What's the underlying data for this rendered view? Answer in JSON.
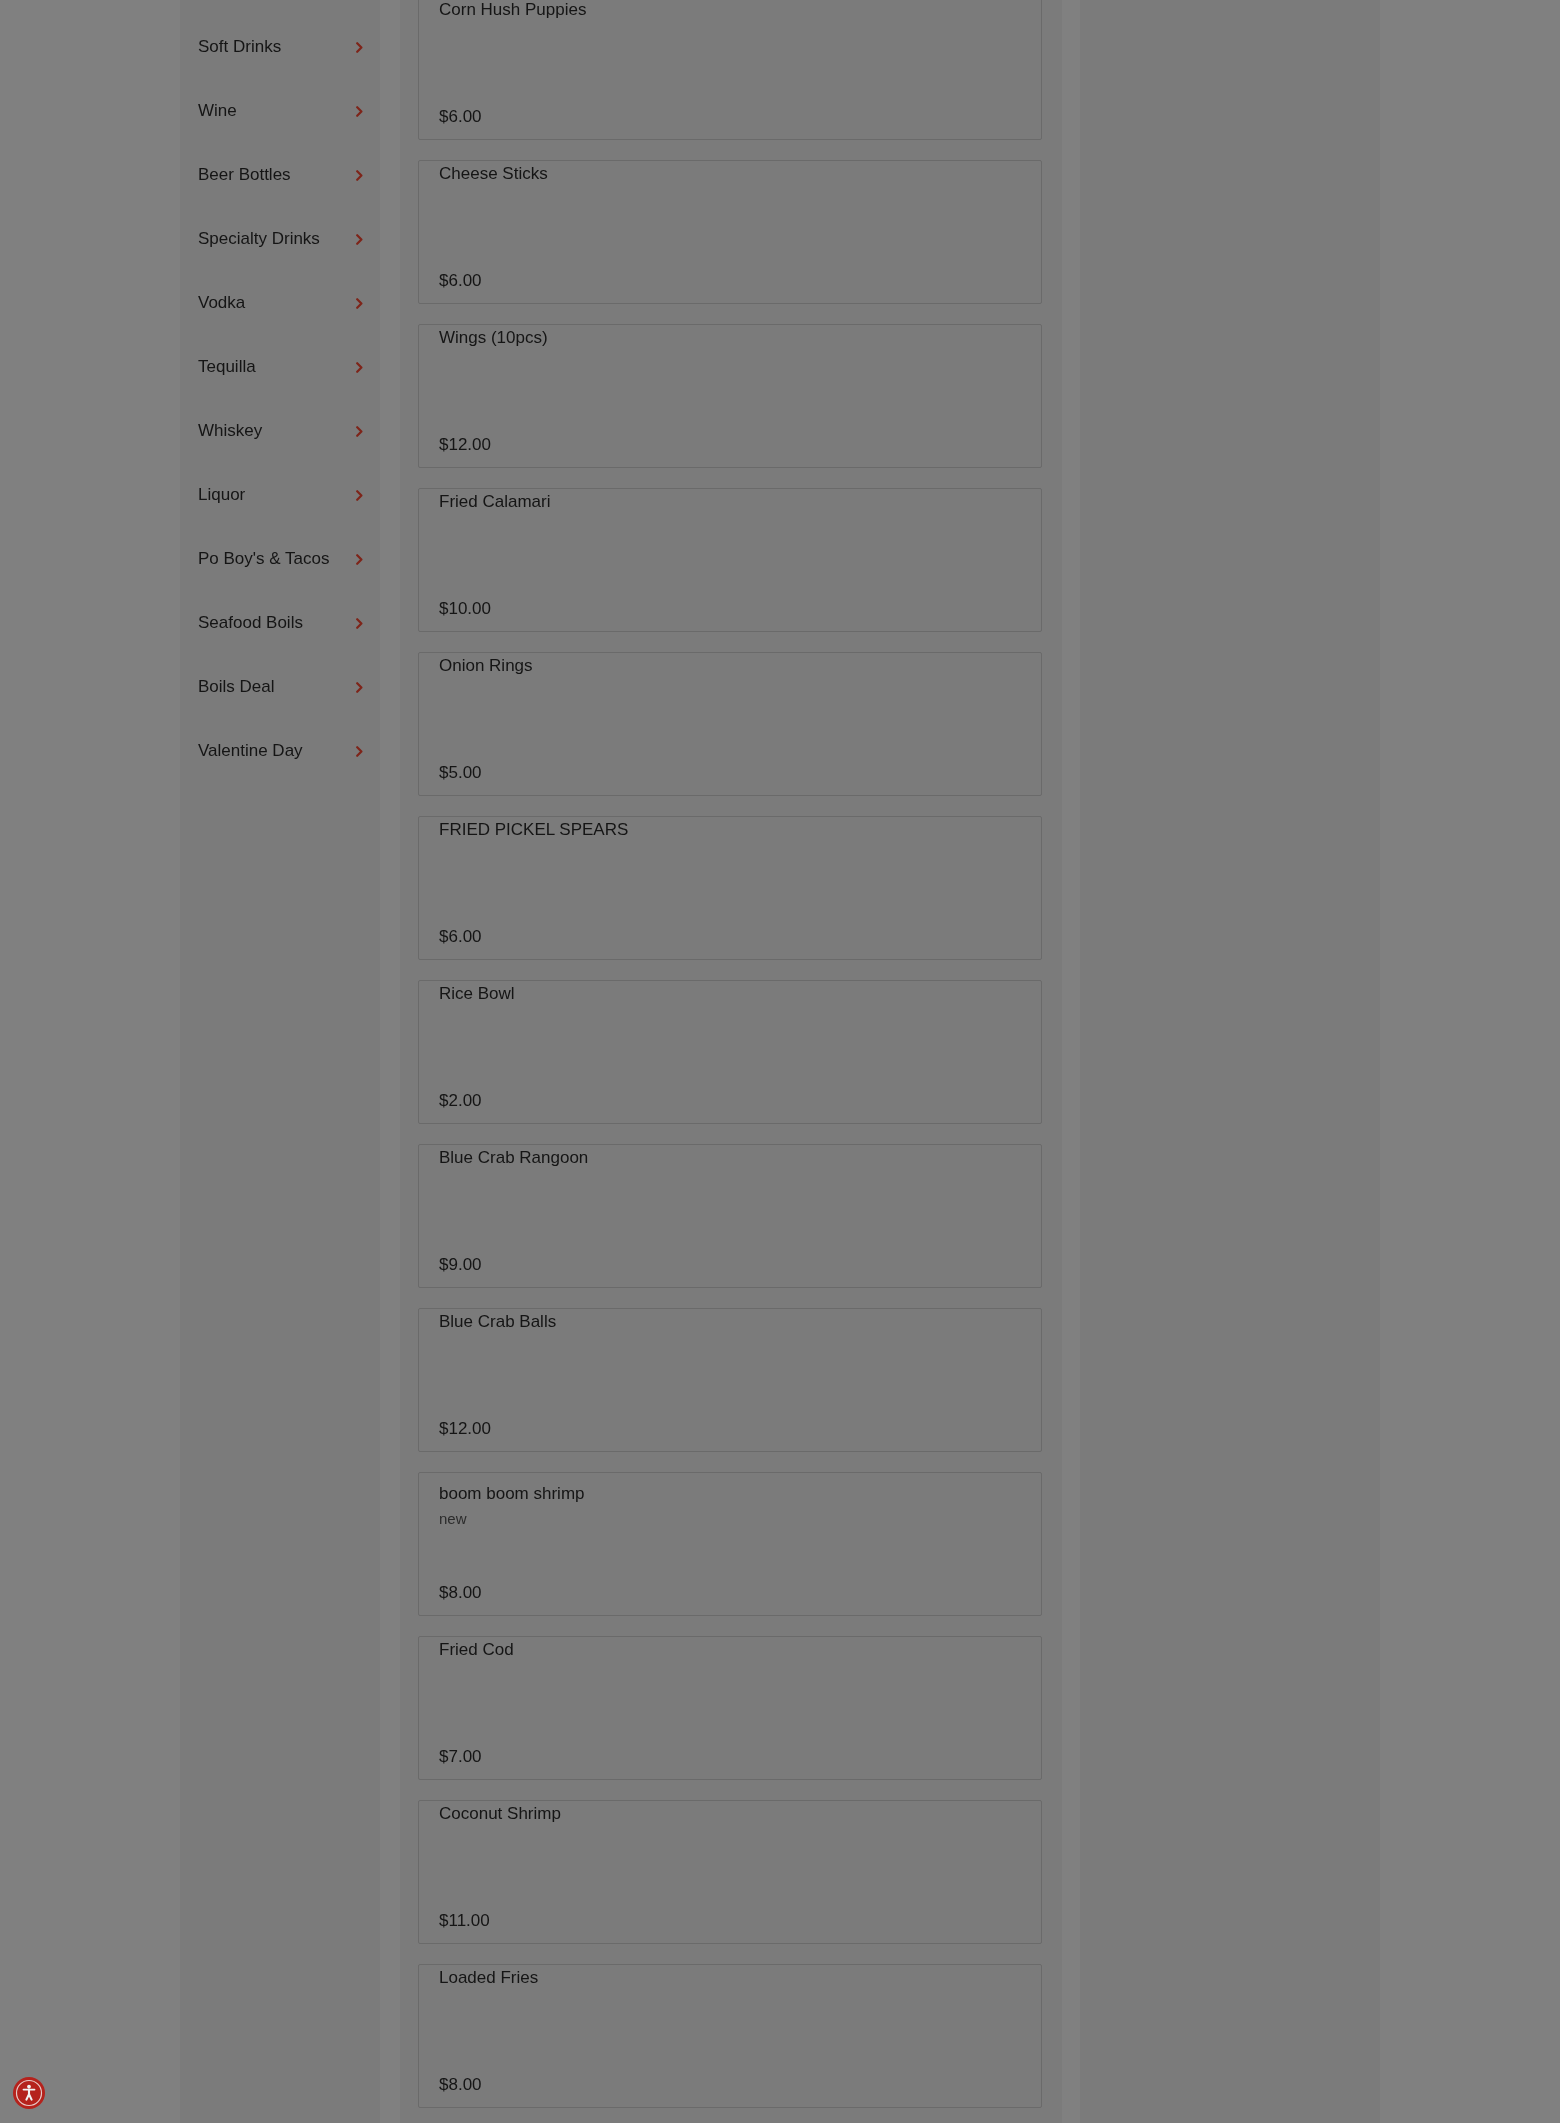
{
  "categories": [
    {
      "label": "Soft Drinks"
    },
    {
      "label": "Wine"
    },
    {
      "label": "Beer Bottles"
    },
    {
      "label": "Specialty Drinks"
    },
    {
      "label": "Vodka"
    },
    {
      "label": "Tequilla"
    },
    {
      "label": "Whiskey"
    },
    {
      "label": "Liquor"
    },
    {
      "label": "Po Boy's & Tacos"
    },
    {
      "label": "Seafood Boils"
    },
    {
      "label": "Boils Deal"
    },
    {
      "label": "Valentine Day"
    }
  ],
  "menu_items": [
    {
      "name": "Corn Hush Puppies",
      "price": "$6.00"
    },
    {
      "name": "Cheese Sticks",
      "price": "$6.00"
    },
    {
      "name": "Wings (10pcs)",
      "price": "$12.00"
    },
    {
      "name": "Fried Calamari",
      "price": "$10.00"
    },
    {
      "name": "Onion Rings",
      "price": "$5.00"
    },
    {
      "name": "FRIED PICKEL SPEARS",
      "price": "$6.00"
    },
    {
      "name": "Rice Bowl",
      "price": "$2.00"
    },
    {
      "name": "Blue Crab Rangoon",
      "price": "$9.00"
    },
    {
      "name": "Blue Crab Balls",
      "price": "$12.00"
    },
    {
      "name": "boom boom shrimp",
      "description": "new",
      "price": "$8.00"
    },
    {
      "name": "Fried Cod",
      "price": "$7.00"
    },
    {
      "name": "Coconut Shrimp",
      "price": "$11.00"
    },
    {
      "name": "Loaded Fries",
      "price": "$8.00"
    }
  ]
}
